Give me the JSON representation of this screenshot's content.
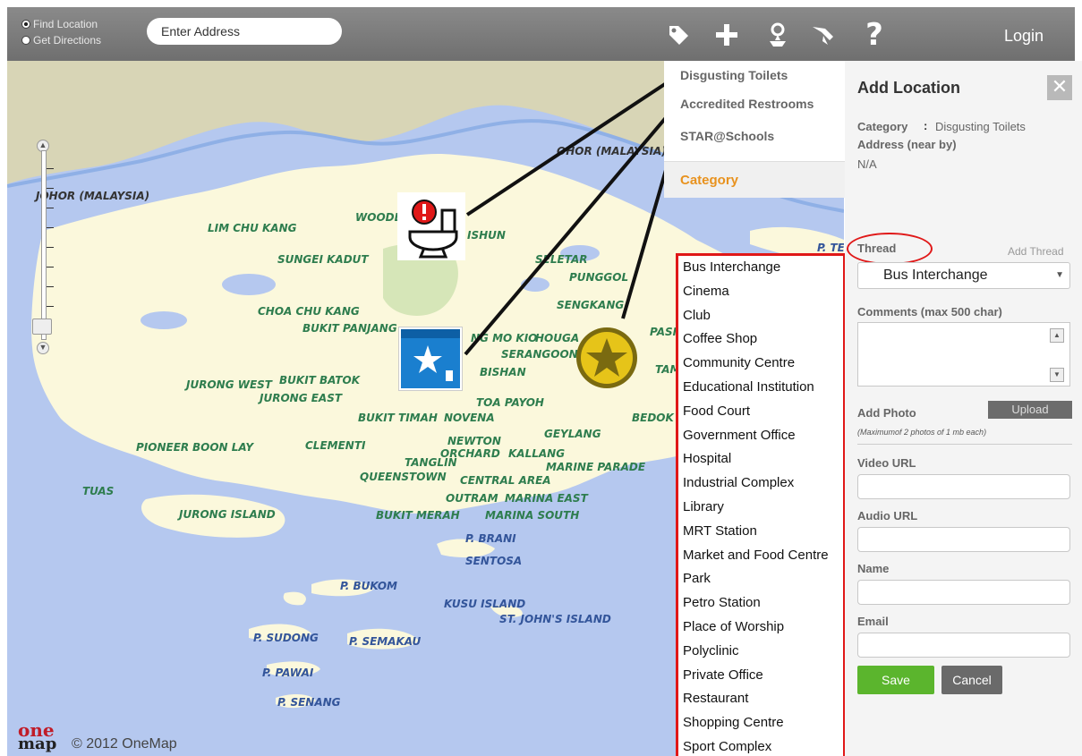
{
  "topbar": {
    "find_location": "Find Location",
    "get_directions": "Get Directions",
    "search_placeholder": "Enter Address",
    "login": "Login"
  },
  "map": {
    "places": {
      "johor1": "OHOR (MALAYSIA)",
      "johor2": "JOHOR (MALAYSIA)",
      "lim_chu_kang": "LIM CHU KANG",
      "woodlands": "WOODL",
      "yishun": "ISHUN",
      "sungei_kadut": "SUNGEI KADUT",
      "seletar": "SELETAR",
      "punggol": "PUNGGOL",
      "sengkang": "SENGKANG",
      "pasir": "PASIR",
      "p_te": "P. TE",
      "choa_chu_kang": "CHOA CHU KANG",
      "bukit_panjang": "BUKIT PANJANG",
      "ang_mo_kio": "NG MO KIO",
      "hougang": "HOUGA",
      "serangoon": "SERANGOON",
      "bishan": "BISHAN",
      "tam": "TAM",
      "jurong_west": "JURONG WEST",
      "bukit_batok": "BUKIT BATOK",
      "jurong_east": "JURONG EAST",
      "toa_payoh": "TOA PAYOH",
      "bedok": "BEDOK",
      "bukit_timah": "BUKIT TIMAH",
      "novena": "NOVENA",
      "geylang": "GEYLANG",
      "newton": "NEWTON",
      "orchard": "ORCHARD",
      "kallang": "KALLANG",
      "pioneer": "PIONEER",
      "boon_lay": "BOON LAY",
      "clementi": "CLEMENTI",
      "tanglin": "TANGLIN",
      "marine_parade": "MARINE PARADE",
      "queenstown": "QUEENSTOWN",
      "central_area": "CENTRAL AREA",
      "tuas": "TUAS",
      "outram": "OUTRAM",
      "marina_east": "MARINA EAST",
      "jurong_island": "JURONG ISLAND",
      "bukit_merah": "BUKIT MERAH",
      "marina_south": "MARINA SOUTH",
      "p_brani": "P. BRANI",
      "sentosa": "SENTOSA",
      "p_bukom": "P. BUKOM",
      "kusu_island": "KUSU ISLAND",
      "st_johns": "ST. JOHN'S ISLAND",
      "p_sudong": "P. SUDONG",
      "p_semakau": "P. SEMAKAU",
      "p_pawai": "P. PAWAI",
      "p_senang": "P. SENANG"
    },
    "logo_top": "one",
    "logo_bottom": "map",
    "copyright": "© 2012 OneMap"
  },
  "legend": {
    "items": [
      "Disgusting Toilets",
      "Accredited Restrooms",
      "STAR@Schools"
    ],
    "category_tab": "Category"
  },
  "category_list": [
    "Bus Interchange",
    "Cinema",
    "Club",
    "Coffee Shop",
    "Community Centre",
    "Educational Institution",
    "Food Court",
    "Government Office",
    "Hospital",
    "Industrial Complex",
    "Library",
    "MRT Station",
    "Market and Food Centre",
    "Park",
    "Petro Station",
    "Place of Worship",
    "Polyclinic",
    "Private Office",
    "Restaurant",
    "Shopping Centre",
    "Sport Complex"
  ],
  "panel": {
    "title": "Add Location",
    "category_label": "Category",
    "category_colon": ":",
    "category_value": "Disgusting Toilets",
    "address_label": "Address (near by)",
    "address_value": "N/A",
    "thread_label": "Thread",
    "add_thread": "Add Thread",
    "thread_selected": "Bus Interchange",
    "comments_label": "Comments (max 500 char)",
    "add_photo_label": "Add Photo",
    "upload_label": "Upload",
    "photo_hint": "(Maximumof 2 photos of 1 mb each)",
    "video_label": "Video URL",
    "audio_label": "Audio URL",
    "name_label": "Name",
    "email_label": "Email",
    "save": "Save",
    "cancel": "Cancel"
  },
  "colors": {
    "accent_red": "#e01818",
    "save_green": "#5bb52d",
    "category_orange": "#e8921e",
    "map_water": "#b5c8ef",
    "map_land": "#fbf8dc"
  }
}
